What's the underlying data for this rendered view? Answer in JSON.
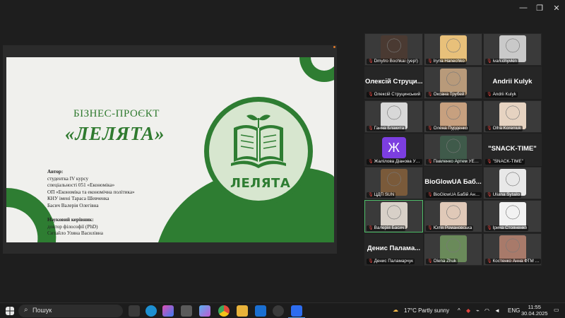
{
  "window": {
    "min": "—",
    "max": "❐",
    "close": "✕"
  },
  "slide": {
    "title_line1": "БІЗНЕС-ПРОЄКТ",
    "title_line2": "«ЛЕЛЯТА»",
    "logo_text": "ЛЕЛЯТА",
    "author_heading": "Автор:",
    "author_lines": [
      "студентка IV курсу",
      "спеціальності 051 «Економіка»",
      "ОП «Економіка та економічна політика»",
      "КНУ імені Тараса Шевченка",
      "Басич Валерія Олегівна"
    ],
    "advisor_heading": "Науковий керівник:",
    "advisor_lines": [
      "доктор філософії (PhD)",
      "Ситайло Уляна Василівна"
    ],
    "colors": {
      "green": "#2e7d32",
      "light_green": "#c9dfc1",
      "bg": "#f0f0ed"
    }
  },
  "participants": [
    {
      "caption": "Dmytro Bochkai (yep!)",
      "big": "",
      "video": true,
      "tone": "#4a3a32"
    },
    {
      "caption": "Iryna Hanechko",
      "big": "",
      "video": true,
      "tone": "#e8c07a"
    },
    {
      "caption": "ivan.chyvkin",
      "big": "",
      "video": true,
      "tone": "#c9c9c9"
    },
    {
      "caption": "Олексій Струцинський",
      "big": "Олексій Струци...",
      "video": false
    },
    {
      "caption": "Оксана Трубей",
      "big": "",
      "video": true,
      "tone": "#b89a7a"
    },
    {
      "caption": "Andrii Kulyk",
      "big": "Andrii Kulyk",
      "video": false
    },
    {
      "caption": "Ганна Блакита",
      "big": "",
      "video": true,
      "tone": "#d8d8d8"
    },
    {
      "caption": "Олена Пурденко",
      "big": "",
      "video": true,
      "tone": "#c7a07f"
    },
    {
      "caption": "Olha Koreniuk",
      "big": "",
      "video": true,
      "tone": "#e6d3c1"
    },
    {
      "caption": "Жалілова Діанова УЕ-...",
      "big": "Ж",
      "video": false,
      "avatar": "#7c3ee0"
    },
    {
      "caption": "Павленко Артем УЕ-32",
      "big": "",
      "video": true,
      "tone": "#3f5a4a"
    },
    {
      "caption": "\"SNACK-TIME\"",
      "big": "\"SNACK-TIME\"",
      "video": false
    },
    {
      "caption": "ЦДП SUN",
      "big": "",
      "video": true,
      "tone": "#7a5a3a"
    },
    {
      "caption": "BioGlowUA Бабій Анн...",
      "big": "BioGlowUA Баб...",
      "video": false
    },
    {
      "caption": "Uliana Sytailo",
      "big": "",
      "video": true,
      "tone": "#e8e8e8"
    },
    {
      "caption": "Валерія Басич",
      "big": "",
      "video": true,
      "tone": "#d8d0c8",
      "active": true
    },
    {
      "caption": "Юлія Романовська",
      "big": "",
      "video": true,
      "tone": "#e0c9b8"
    },
    {
      "caption": "Ірина Стояненко",
      "big": "",
      "video": true,
      "tone": "#f2f2f2"
    },
    {
      "caption": "Денис Паламарчук",
      "big": "Денис Паламa...",
      "video": false
    },
    {
      "caption": "Olena Zhuk",
      "big": "",
      "video": true,
      "tone": "#6a8a5a"
    },
    {
      "caption": "Костенко Анна ФТМ 4...",
      "big": "",
      "video": true,
      "tone": "#a87a6a"
    }
  ],
  "taskbar": {
    "search_label": "Пошук",
    "weather": "17°C  Partly sunny",
    "lang": "ENG",
    "time": "11:55",
    "date": "30.04.2025"
  }
}
